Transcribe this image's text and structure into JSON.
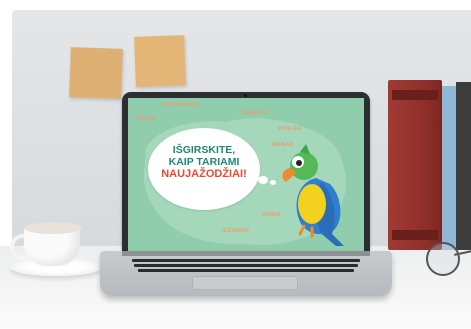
{
  "screen": {
    "bubble": {
      "line1": "IŠGIRSKITE,",
      "line2": "KAIP TARIAMI",
      "line3": "NAUJAŽODŽIAI!"
    },
    "words": [
      "ORIENTE",
      "PABLĖA",
      "MEMAS",
      "ANMIS",
      "IEŠMANO",
      "DŪZĖS",
      "KEZANUNAS"
    ]
  },
  "colors": {
    "screen_bg": "#8fcdac",
    "bubble_text": "#1e8a77",
    "highlight_text": "#e64a2f",
    "faded_words": "#e6a074"
  },
  "icons": [
    "parrot-illustration",
    "coffee-cup",
    "sticky-note",
    "book",
    "eyeglasses"
  ]
}
